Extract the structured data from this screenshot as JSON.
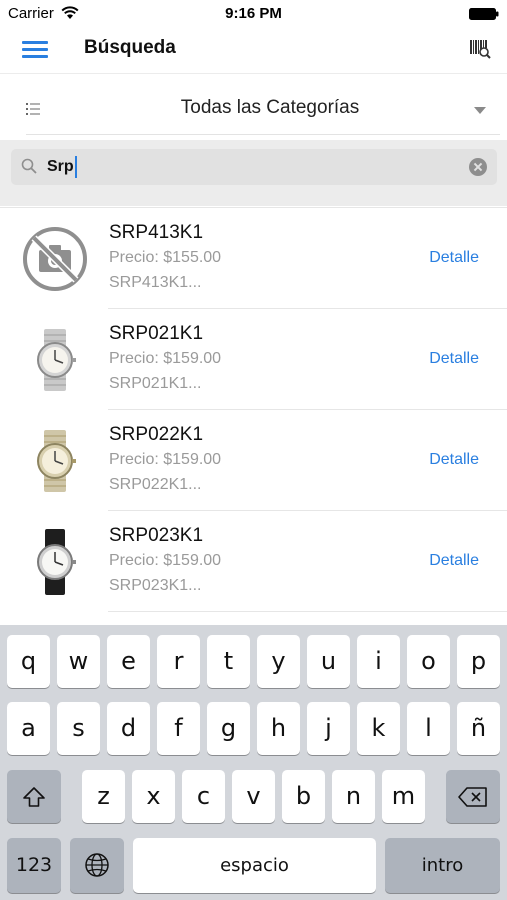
{
  "status_bar": {
    "carrier": "Carrier",
    "time": "9:16 PM"
  },
  "nav": {
    "title": "Búsqueda",
    "menu_icon": "hamburger-menu-icon",
    "barcode_icon": "barcode-scan-icon"
  },
  "category": {
    "label": "Todas las Categorías",
    "icon": "list-icon"
  },
  "search": {
    "value": "Srp",
    "icon": "search-icon"
  },
  "products": [
    {
      "name": "SRP413K1",
      "price": "Precio: $155.00",
      "desc": "SRP413K1...",
      "action": "Detalle",
      "image": "no-photo-icon"
    },
    {
      "name": "SRP021K1",
      "price": "Precio: $159.00",
      "desc": "SRP021K1...",
      "action": "Detalle",
      "image": "silver-watch-image"
    },
    {
      "name": "SRP022K1",
      "price": "Precio: $159.00",
      "desc": "SRP022K1...",
      "action": "Detalle",
      "image": "two-tone-watch-image"
    },
    {
      "name": "SRP023K1",
      "price": "Precio: $159.00",
      "desc": "SRP023K1...",
      "action": "Detalle",
      "image": "leather-watch-image"
    }
  ],
  "keyboard": {
    "row1": [
      "q",
      "w",
      "e",
      "r",
      "t",
      "y",
      "u",
      "i",
      "o",
      "p"
    ],
    "row2": [
      "a",
      "s",
      "d",
      "f",
      "g",
      "h",
      "j",
      "k",
      "l",
      "ñ"
    ],
    "row3": [
      "z",
      "x",
      "c",
      "v",
      "b",
      "n",
      "m"
    ],
    "numbers_label": "123",
    "space_label": "espacio",
    "return_label": "intro"
  },
  "colors": {
    "accent": "#2a7fe0",
    "keyboard_bg": "#d3d6db",
    "key_dark": "#adb3bc"
  }
}
